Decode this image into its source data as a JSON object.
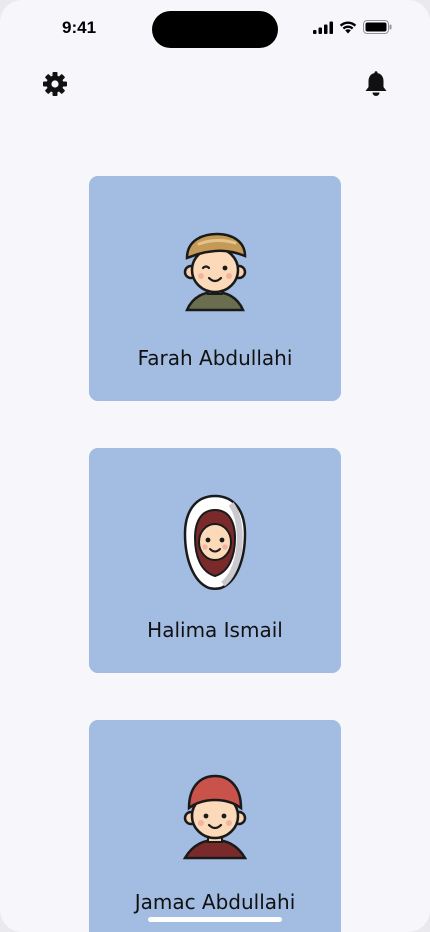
{
  "status_bar": {
    "time": "9:41",
    "icons": [
      "cellular-signal-icon",
      "wifi-icon",
      "battery-icon"
    ]
  },
  "top_bar": {
    "left_icon": "gear-icon",
    "right_icon": "bell-icon"
  },
  "profiles": [
    {
      "name": "Farah Abdullahi",
      "avatar": "boy-with-cap-avatar"
    },
    {
      "name": "Halima Ismail",
      "avatar": "girl-with-hijab-avatar"
    },
    {
      "name": "Jamac Abdullahi",
      "avatar": "boy-with-red-hat-avatar"
    }
  ],
  "colors": {
    "background": "#f7f7fb",
    "card": "#a2bce2",
    "text": "#111111"
  }
}
